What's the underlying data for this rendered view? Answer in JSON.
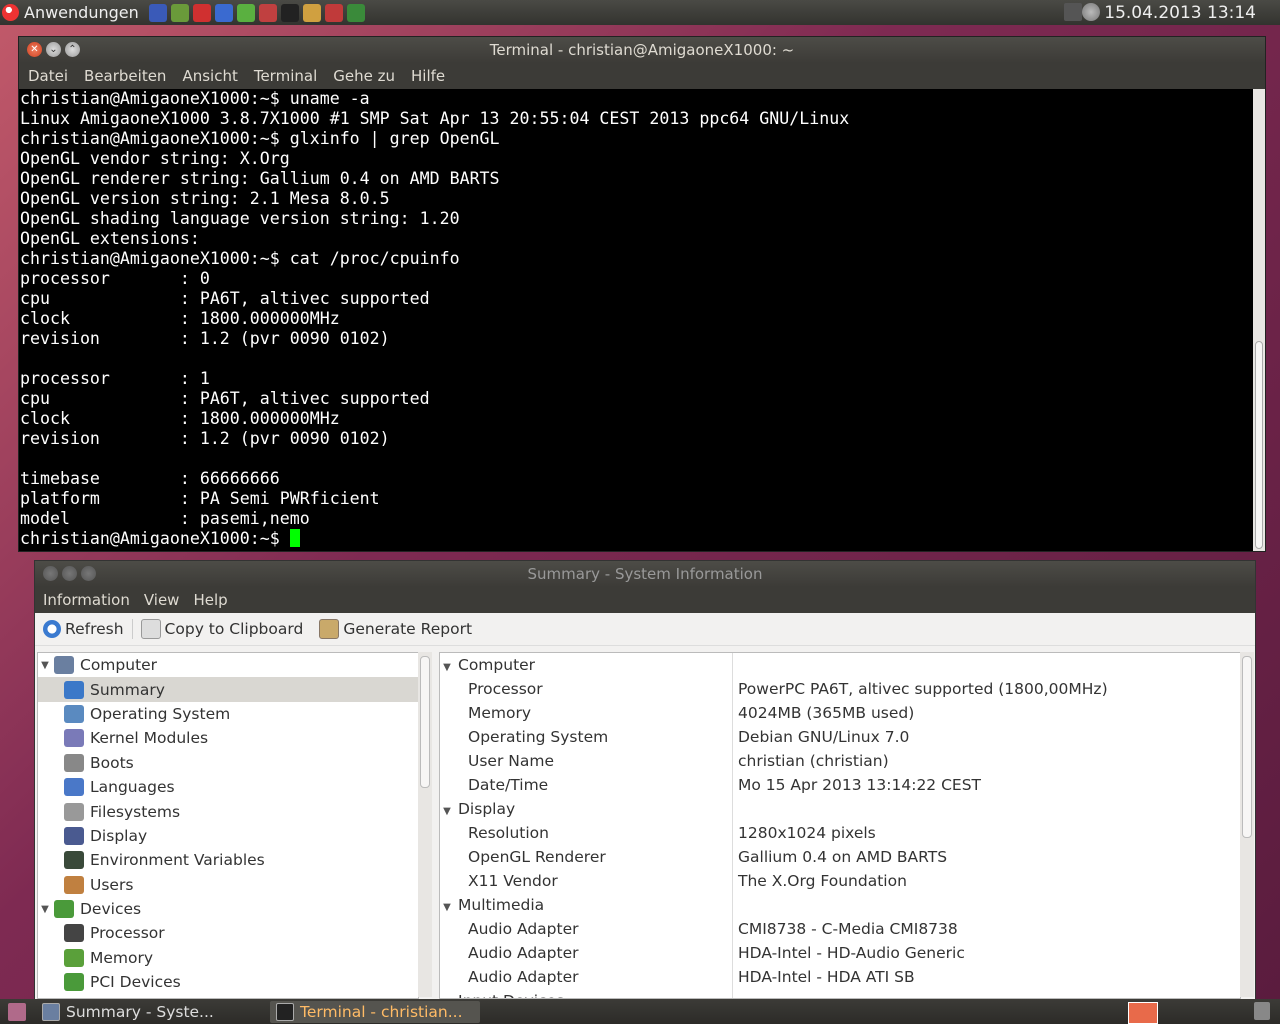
{
  "top_panel": {
    "apps_menu_label": "Anwendungen",
    "launchers": [
      "browser-icon",
      "network-icon",
      "mail-icon",
      "bluetooth-icon",
      "package-icon",
      "blender-icon",
      "terminal-icon",
      "files-icon",
      "palette-icon",
      "docs-icon"
    ],
    "clock": "15.04.2013 13:14"
  },
  "terminal": {
    "title": "Terminal - christian@AmigaoneX1000: ~",
    "menu": [
      "Datei",
      "Bearbeiten",
      "Ansicht",
      "Terminal",
      "Gehe zu",
      "Hilfe"
    ],
    "lines": [
      "christian@AmigaoneX1000:~$ uname -a",
      "Linux AmigaoneX1000 3.8.7X1000 #1 SMP Sat Apr 13 20:55:04 CEST 2013 ppc64 GNU/Linux",
      "christian@AmigaoneX1000:~$ glxinfo | grep OpenGL",
      "OpenGL vendor string: X.Org",
      "OpenGL renderer string: Gallium 0.4 on AMD BARTS",
      "OpenGL version string: 2.1 Mesa 8.0.5",
      "OpenGL shading language version string: 1.20",
      "OpenGL extensions:",
      "christian@AmigaoneX1000:~$ cat /proc/cpuinfo",
      "processor       : 0",
      "cpu             : PA6T, altivec supported",
      "clock           : 1800.000000MHz",
      "revision        : 1.2 (pvr 0090 0102)",
      "",
      "processor       : 1",
      "cpu             : PA6T, altivec supported",
      "clock           : 1800.000000MHz",
      "revision        : 1.2 (pvr 0090 0102)",
      "",
      "timebase        : 66666666",
      "platform        : PA Semi PWRficient",
      "model           : pasemi,nemo"
    ],
    "prompt": "christian@AmigaoneX1000:~$ "
  },
  "sysinfo": {
    "title": "Summary - System Information",
    "menu": [
      "Information",
      "View",
      "Help"
    ],
    "toolbar": {
      "refresh": "Refresh",
      "copy": "Copy to Clipboard",
      "report": "Generate Report"
    },
    "tree": [
      {
        "label": "Computer",
        "level": 0,
        "expanded": true,
        "icon": "computer-icon",
        "color": "#6a7fa0"
      },
      {
        "label": "Summary",
        "level": 1,
        "selected": true,
        "icon": "info-icon",
        "color": "#3b78c8"
      },
      {
        "label": "Operating System",
        "level": 1,
        "icon": "gear-icon",
        "color": "#5a8ac0"
      },
      {
        "label": "Kernel Modules",
        "level": 1,
        "icon": "module-icon",
        "color": "#7a7ab8"
      },
      {
        "label": "Boots",
        "level": 1,
        "icon": "power-icon",
        "color": "#888888"
      },
      {
        "label": "Languages",
        "level": 1,
        "icon": "flag-icon",
        "color": "#4a78c8"
      },
      {
        "label": "Filesystems",
        "level": 1,
        "icon": "drive-icon",
        "color": "#999999"
      },
      {
        "label": "Display",
        "level": 1,
        "icon": "monitor-icon",
        "color": "#4a5a90"
      },
      {
        "label": "Environment Variables",
        "level": 1,
        "icon": "terminal-icon",
        "color": "#3a4a3a"
      },
      {
        "label": "Users",
        "level": 1,
        "icon": "users-icon",
        "color": "#c08040"
      },
      {
        "label": "Devices",
        "level": 0,
        "expanded": true,
        "icon": "chip-icon",
        "color": "#4a9a3a"
      },
      {
        "label": "Processor",
        "level": 1,
        "icon": "cpu-icon",
        "color": "#444444"
      },
      {
        "label": "Memory",
        "level": 1,
        "icon": "memory-icon",
        "color": "#5aa03a"
      },
      {
        "label": "PCI Devices",
        "level": 1,
        "icon": "pci-icon",
        "color": "#4a9a3a"
      }
    ],
    "details": [
      {
        "label": "Computer",
        "group": true
      },
      {
        "label": "Processor",
        "value": "PowerPC PA6T, altivec supported (1800,00MHz)"
      },
      {
        "label": "Memory",
        "value": "4024MB (365MB used)"
      },
      {
        "label": "Operating System",
        "value": "Debian GNU/Linux 7.0"
      },
      {
        "label": "User Name",
        "value": "christian (christian)"
      },
      {
        "label": "Date/Time",
        "value": "Mo 15 Apr 2013 13:14:22 CEST"
      },
      {
        "label": "Display",
        "group": true
      },
      {
        "label": "Resolution",
        "value": "1280x1024 pixels"
      },
      {
        "label": "OpenGL Renderer",
        "value": "Gallium 0.4 on AMD BARTS"
      },
      {
        "label": "X11 Vendor",
        "value": "The X.Org Foundation"
      },
      {
        "label": "Multimedia",
        "group": true
      },
      {
        "label": "Audio Adapter",
        "value": "CMI8738 - C-Media CMI8738"
      },
      {
        "label": "Audio Adapter",
        "value": "HDA-Intel - HD-Audio Generic"
      },
      {
        "label": "Audio Adapter",
        "value": "HDA-Intel - HDA ATI SB"
      },
      {
        "label": "Input Devices",
        "group": true
      }
    ]
  },
  "taskbar": {
    "tasks": [
      {
        "label": "Summary - Syste...",
        "active": false
      },
      {
        "label": "Terminal - christian...",
        "active": true
      }
    ]
  }
}
